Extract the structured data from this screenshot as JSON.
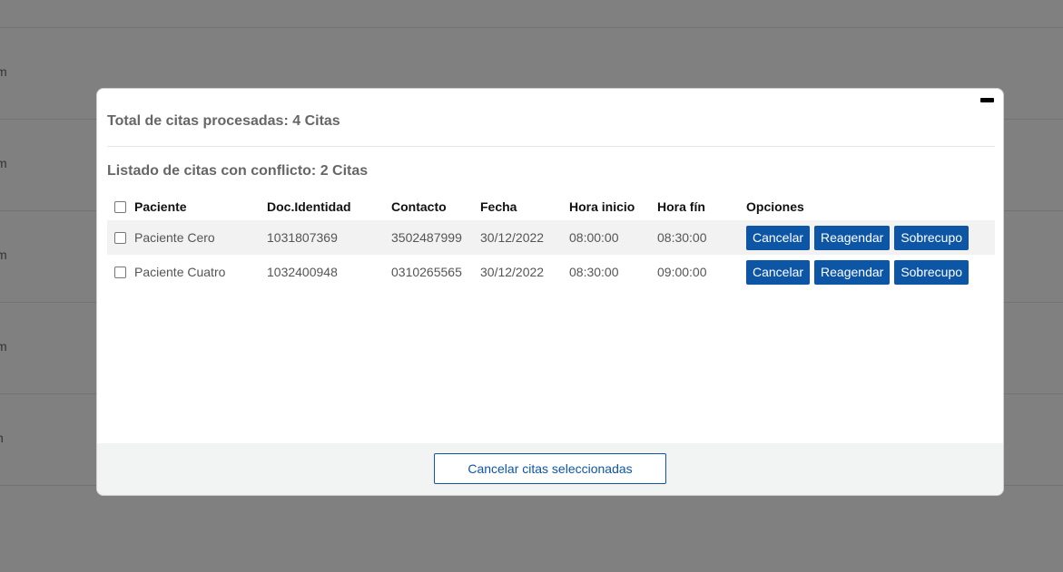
{
  "background": {
    "row_fragments": [
      "m",
      "m",
      "m",
      "m",
      "n"
    ]
  },
  "modal": {
    "total_title": "Total de citas procesadas: 4 Citas",
    "conflict_title": "Listado de citas con conflicto: 2 Citas",
    "columns": [
      "Paciente",
      "Doc.Identidad",
      "Contacto",
      "Fecha",
      "Hora inicio",
      "Hora fín",
      "Opciones"
    ],
    "rows": [
      {
        "paciente": "Paciente Cero",
        "doc": "1031807369",
        "contacto": "3502487999",
        "fecha": "30/12/2022",
        "hora_inicio": "08:00:00",
        "hora_fin": "08:30:00"
      },
      {
        "paciente": "Paciente Cuatro",
        "doc": "1032400948",
        "contacto": "0310265565",
        "fecha": "30/12/2022",
        "hora_inicio": "08:30:00",
        "hora_fin": "09:00:00"
      }
    ],
    "actions": {
      "cancel": "Cancelar",
      "reschedule": "Reagendar",
      "overbook": "Sobrecupo"
    },
    "footer_button": "Cancelar citas seleccionadas"
  },
  "colors": {
    "primary": "#0d56a6",
    "overlay": "#808080"
  }
}
